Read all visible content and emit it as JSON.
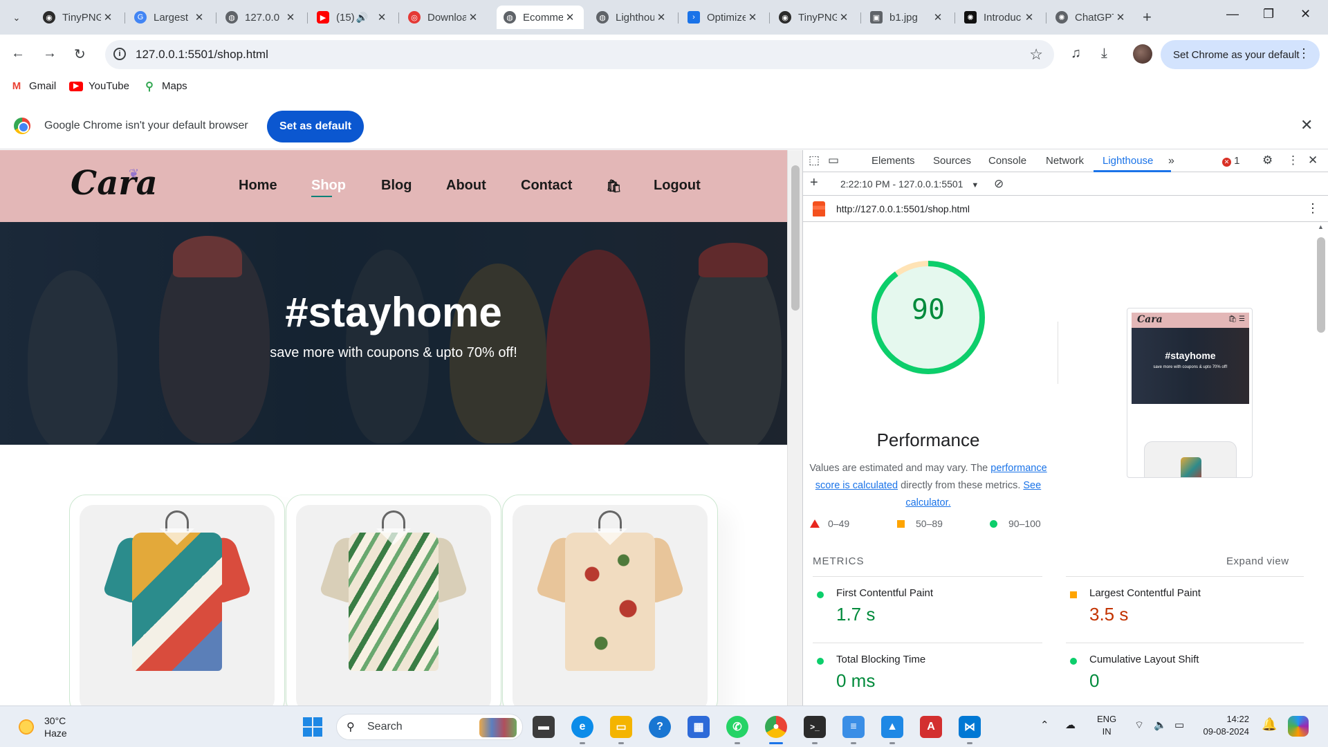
{
  "browser": {
    "tabs": [
      {
        "title": "TinyPNG",
        "active": false,
        "fav_color": "#2b2b2b"
      },
      {
        "title": "Largest",
        "active": false,
        "fav_color": "#4285f4"
      },
      {
        "title": "127.0.0",
        "active": false,
        "fav_color": "#5f6368"
      },
      {
        "title": "(15)",
        "active": false,
        "fav_color": "#ff0000"
      },
      {
        "title": "Download",
        "active": false,
        "fav_color": "#e53935"
      },
      {
        "title": "Ecommerce",
        "active": true,
        "fav_color": "#5f6368"
      },
      {
        "title": "Lighthouse",
        "active": false,
        "fav_color": "#5f6368"
      },
      {
        "title": "Optimize",
        "active": false,
        "fav_color": "#1a73e8"
      },
      {
        "title": "TinyPNG",
        "active": false,
        "fav_color": "#2b2b2b"
      },
      {
        "title": "b1.jpg",
        "active": false,
        "fav_color": "#5f6368"
      },
      {
        "title": "Introduc",
        "active": false,
        "fav_color": "#111111"
      },
      {
        "title": "ChatGPT",
        "active": false,
        "fav_color": "#5f6368"
      }
    ],
    "url": "127.0.0.1:5501/shop.html",
    "set_default_pill": "Set Chrome as your default",
    "bookmarks": [
      {
        "label": "Gmail",
        "icon": "gmail-icon",
        "color": "#ea4335"
      },
      {
        "label": "YouTube",
        "icon": "youtube-icon",
        "color": "#ff0000"
      },
      {
        "label": "Maps",
        "icon": "maps-icon",
        "color": "#34a853"
      }
    ],
    "infobar": {
      "text": "Google Chrome isn't your default browser",
      "button": "Set as default"
    }
  },
  "site": {
    "logo": "Cara",
    "nav": [
      {
        "label": "Home",
        "active": false
      },
      {
        "label": "Shop",
        "active": true
      },
      {
        "label": "Blog",
        "active": false
      },
      {
        "label": "About",
        "active": false
      },
      {
        "label": "Contact",
        "active": false
      },
      {
        "label": "Logout",
        "active": false
      }
    ],
    "hero": {
      "title": "#stayhome",
      "subtitle": "save more with coupons & upto 70% off!"
    },
    "products": [
      {
        "name": "patchwork-print-shirt",
        "colors": [
          "#e3a93a",
          "#2b8c8c",
          "#d94c3d",
          "#f4f0e6"
        ]
      },
      {
        "name": "tropical-leaf-shirt",
        "colors": [
          "#efe6d4",
          "#3a7d44",
          "#f7f1e3",
          "#6aa86f"
        ]
      },
      {
        "name": "floral-rose-shirt",
        "colors": [
          "#f1dcc0",
          "#b83a2f",
          "#4f7a3b",
          "#e8c59a"
        ]
      }
    ]
  },
  "devtools": {
    "tabs": [
      "Elements",
      "Sources",
      "Console",
      "Network",
      "Lighthouse"
    ],
    "active_tab": "Lighthouse",
    "error_count": "1",
    "report_select": "2:22:10 PM - 127.0.0.1:5501",
    "report_url": "http://127.0.0.1:5501/shop.html",
    "score": "90",
    "score_fraction": 0.9,
    "category": "Performance",
    "description_1": "Values are estimated and may vary. The",
    "description_link": "performance score is calculated",
    "description_2": "directly from these metrics.",
    "calculator_link": "See calculator.",
    "legend": [
      "0–49",
      "50–89",
      "90–100"
    ],
    "thumbnail": {
      "logo": "Cara",
      "title": "#stayhome",
      "subtitle": "save more with coupons & upto 70% off!"
    },
    "metrics_title": "METRICS",
    "expand_view": "Expand view",
    "metrics": [
      {
        "name": "First Contentful Paint",
        "value": "1.7 s",
        "rating": "good"
      },
      {
        "name": "Largest Contentful Paint",
        "value": "3.5 s",
        "rating": "average"
      },
      {
        "name": "Total Blocking Time",
        "value": "0 ms",
        "rating": "good"
      },
      {
        "name": "Cumulative Layout Shift",
        "value": "0",
        "rating": "good"
      }
    ]
  },
  "taskbar": {
    "weather": {
      "temp": "30°C",
      "condition": "Haze"
    },
    "search_placeholder": "Search",
    "language": {
      "line1": "ENG",
      "line2": "IN"
    },
    "time": "14:22",
    "date": "09-08-2024",
    "apps": [
      {
        "name": "file-explorer-dark",
        "color": "#3c3c3c",
        "glyph": "▬"
      },
      {
        "name": "edge",
        "color": "#0c8ce9",
        "glyph": "e"
      },
      {
        "name": "file-explorer",
        "color": "#f4b400",
        "glyph": "▭"
      },
      {
        "name": "help",
        "color": "#1976d2",
        "glyph": "?"
      },
      {
        "name": "store",
        "color": "#2d6ad8",
        "glyph": "▦"
      },
      {
        "name": "whatsapp",
        "color": "#25d366",
        "glyph": "✆"
      },
      {
        "name": "chrome",
        "color": "#4285f4",
        "glyph": "●"
      },
      {
        "name": "terminal",
        "color": "#2b2b2b",
        "glyph": ">_"
      },
      {
        "name": "notepad",
        "color": "#3a8ee6",
        "glyph": "≡"
      },
      {
        "name": "photos",
        "color": "#1e88e5",
        "glyph": "▲"
      },
      {
        "name": "acrobat",
        "color": "#d32f2f",
        "glyph": "A"
      },
      {
        "name": "vscode",
        "color": "#0078d4",
        "glyph": "⋈"
      }
    ]
  }
}
